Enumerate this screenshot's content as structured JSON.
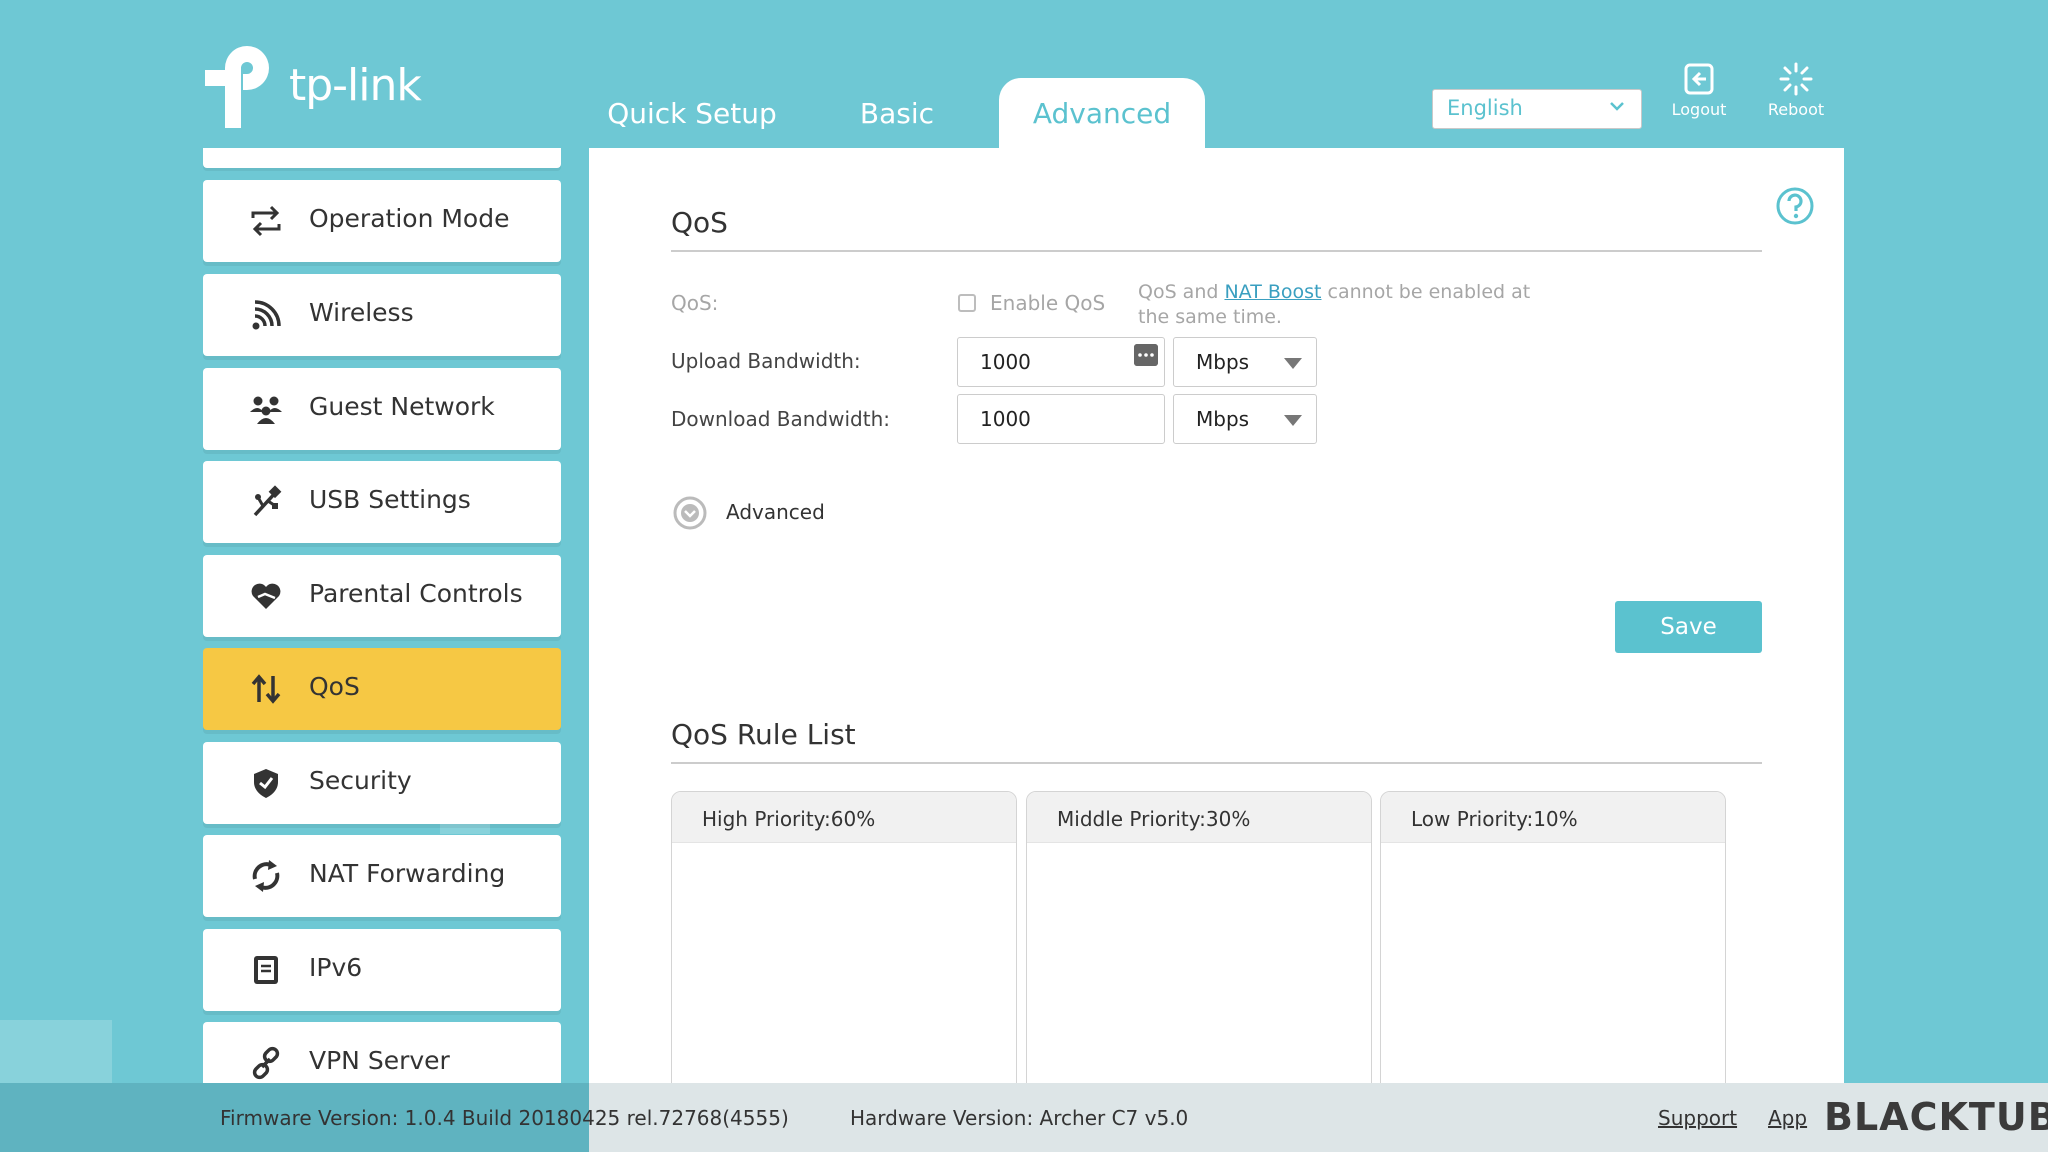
{
  "brand": {
    "logo_text": "tp-link"
  },
  "header": {
    "tabs": [
      {
        "label": "Quick Setup"
      },
      {
        "label": "Basic"
      },
      {
        "label": "Advanced",
        "active": true
      }
    ],
    "language": "English",
    "logout_label": "Logout",
    "reboot_label": "Reboot"
  },
  "sidebar": {
    "items": [
      {
        "label": "Operation Mode",
        "icon": "operation-mode-icon"
      },
      {
        "label": "Wireless",
        "icon": "wireless-icon"
      },
      {
        "label": "Guest Network",
        "icon": "guest-network-icon"
      },
      {
        "label": "USB Settings",
        "icon": "usb-icon"
      },
      {
        "label": "Parental Controls",
        "icon": "parental-controls-icon"
      },
      {
        "label": "QoS",
        "icon": "qos-icon",
        "active": true
      },
      {
        "label": "Security",
        "icon": "shield-icon"
      },
      {
        "label": "NAT Forwarding",
        "icon": "nat-forwarding-icon"
      },
      {
        "label": "IPv6",
        "icon": "ipv6-icon"
      },
      {
        "label": "VPN Server",
        "icon": "vpn-link-icon"
      }
    ]
  },
  "qos": {
    "title": "QoS",
    "qos_label": "QoS:",
    "enable_label": "Enable QoS",
    "enabled": false,
    "note_before": "QoS and ",
    "note_link": "NAT Boost",
    "note_after": " cannot be enabled at the same time.",
    "upload_label": "Upload Bandwidth:",
    "upload_value": "1000",
    "upload_unit": "Mbps",
    "download_label": "Download Bandwidth:",
    "download_value": "1000",
    "download_unit": "Mbps",
    "advanced_label": "Advanced",
    "save_label": "Save"
  },
  "rule_list": {
    "title": "QoS Rule List",
    "boxes": [
      {
        "label": "High Priority:60%"
      },
      {
        "label": "Middle Priority:30%"
      },
      {
        "label": "Low Priority:10%"
      }
    ]
  },
  "footer": {
    "firmware": "Firmware Version: 1.0.4 Build 20180425 rel.72768(4555)",
    "hardware": "Hardware Version: Archer C7 v5.0",
    "support": "Support",
    "app": "App",
    "watermark": "BLACKTUBI"
  },
  "colors": {
    "accent": "#5bc2cf",
    "background": "#6ec8d4",
    "active_item": "#f6c844"
  }
}
